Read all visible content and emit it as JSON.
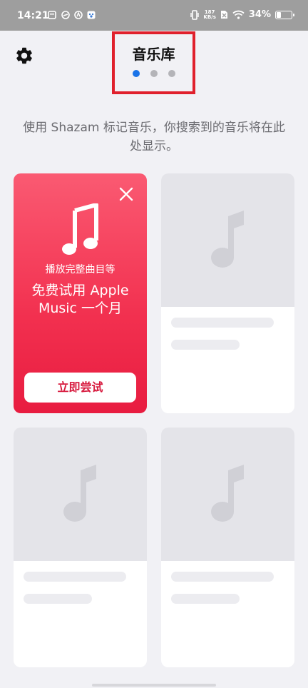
{
  "status_bar": {
    "time": "14:21",
    "net_speed_value": "187",
    "net_speed_unit": "KB/s",
    "battery_percent": "34%",
    "battery_level": 0.34
  },
  "header": {
    "title": "音乐库",
    "page_count": 3,
    "active_page": 1
  },
  "empty_message": "使用 Shazam 标记音乐，你搜索到的音乐将在此处显示。",
  "promo": {
    "subtitle": "播放完整曲目等",
    "headline": "免费试用 Apple Music 一个月",
    "cta_label": "立即尝试"
  },
  "colors": {
    "accent": "#1a73e8",
    "promo_red": "#f2304f",
    "highlight_border": "#e0202c"
  }
}
